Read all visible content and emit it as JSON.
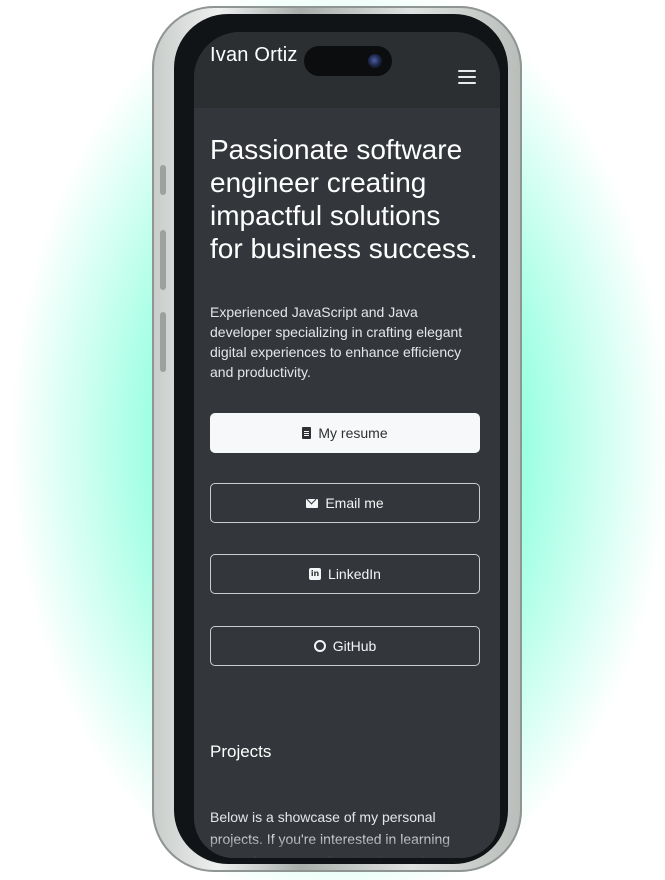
{
  "navbar": {
    "brand": "Ivan Ortiz",
    "menu_icon": "hamburger-menu-icon"
  },
  "hero": {
    "title": "Passionate software engineer creating impactful solutions for business success.",
    "lead": "Experienced JavaScript and Java developer specializing in crafting elegant digital experiences to enhance efficiency and productivity."
  },
  "actions": [
    {
      "label": "My resume",
      "icon": "document-icon"
    },
    {
      "label": "Email me",
      "icon": "envelope-icon"
    },
    {
      "label": "LinkedIn",
      "icon": "linkedin-icon"
    },
    {
      "label": "GitHub",
      "icon": "github-icon"
    }
  ],
  "projects": {
    "title": "Projects",
    "text": "Below is a showcase of my personal projects. If you're interested in learning more about my professional experiences, you can find more"
  },
  "colors": {
    "background_accent": "#74ffd6",
    "screen_bg": "#33373b",
    "navbar_bg": "#2b2f32",
    "primary_button_bg": "#f7f8f9"
  }
}
